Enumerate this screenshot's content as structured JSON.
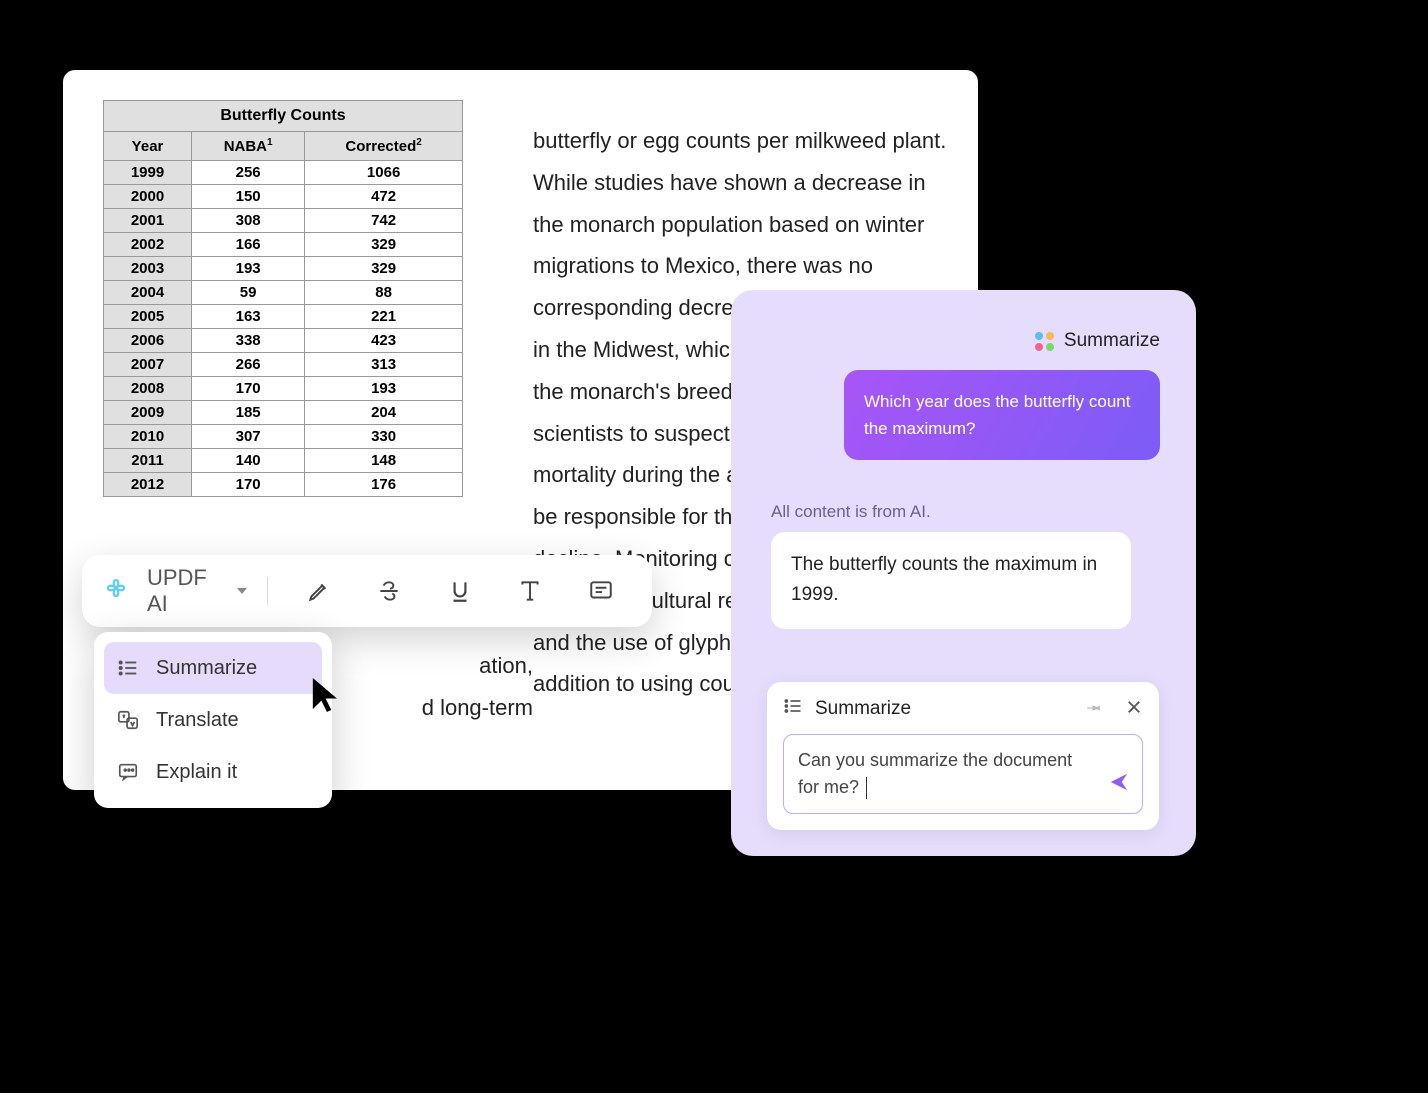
{
  "document": {
    "table_title": "Butterfly Counts",
    "columns": {
      "year": "Year",
      "naba": "NABA",
      "naba_sup": "1",
      "corrected": "Corrected",
      "corrected_sup": "2"
    },
    "rows": [
      {
        "year": "1999",
        "naba": "256",
        "corrected": "1066"
      },
      {
        "year": "2000",
        "naba": "150",
        "corrected": "472"
      },
      {
        "year": "2001",
        "naba": "308",
        "corrected": "742"
      },
      {
        "year": "2002",
        "naba": "166",
        "corrected": "329"
      },
      {
        "year": "2003",
        "naba": "193",
        "corrected": "329"
      },
      {
        "year": "2004",
        "naba": "59",
        "corrected": "88"
      },
      {
        "year": "2005",
        "naba": "163",
        "corrected": "221"
      },
      {
        "year": "2006",
        "naba": "338",
        "corrected": "423"
      },
      {
        "year": "2007",
        "naba": "266",
        "corrected": "313"
      },
      {
        "year": "2008",
        "naba": "170",
        "corrected": "193"
      },
      {
        "year": "2009",
        "naba": "185",
        "corrected": "204"
      },
      {
        "year": "2010",
        "naba": "307",
        "corrected": "330"
      },
      {
        "year": "2011",
        "naba": "140",
        "corrected": "148"
      },
      {
        "year": "2012",
        "naba": "170",
        "corrected": "176"
      }
    ],
    "body_text": "butterfly or egg counts per milkweed plant. While studies have shown a decrease in the monarch population based on winter migrations to Mexico, there was no corresponding decrease in summer counts in the Midwest, which forms the heart of the monarch's breeding range. This led scientists to suspect that increased mortality during the autumn migration may be responsible for the overall population decline. Monitoring of milkweed plants across agricultural regions of the Midwest and the use of glyphosate herbicides, in addition to using count data to e",
    "body_text_left_frag1": "ation,",
    "body_text_left_frag2": "d long-term"
  },
  "toolbar": {
    "brand": "UPDF AI"
  },
  "menu": {
    "summarize": "Summarize",
    "translate": "Translate",
    "explain": "Explain it"
  },
  "chat": {
    "header_label": "Summarize",
    "user_message": "Which year does the butterfly count the maximum?",
    "ai_note": "All content is from AI.",
    "ai_message": "The butterfly counts the maximum in 1999.",
    "input_label": "Summarize",
    "input_text": "Can you summarize the document for me? "
  },
  "colors": {
    "accent_purple": "#8b5cf6",
    "bubble_gradient_start": "#a855f7",
    "bubble_gradient_end": "#7c5cf5",
    "panel_bg": "#e5ddfb"
  }
}
